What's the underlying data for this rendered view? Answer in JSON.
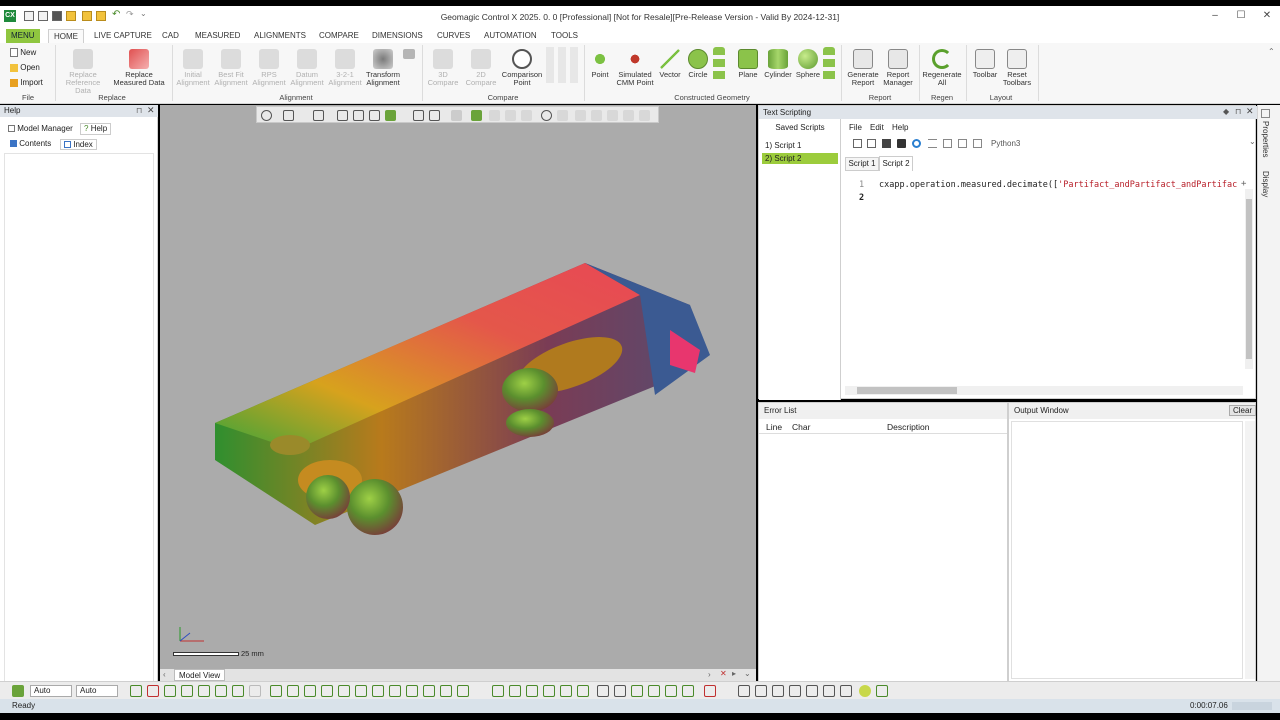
{
  "window": {
    "title": "Geomagic Control X 2025. 0. 0 [Professional] [Not for Resale][Pre-Release Version - Valid By 2024-12-31]",
    "logo_text": "CX"
  },
  "tabs": [
    "MENU",
    "HOME",
    "LIVE CAPTURE",
    "CAD",
    "MEASURED",
    "ALIGNMENTS",
    "COMPARE",
    "DIMENSIONS",
    "CURVES",
    "AUTOMATION",
    "TOOLS"
  ],
  "ribbon": {
    "file": {
      "new": "New",
      "open": "Open",
      "import": "Import",
      "label": "File"
    },
    "replace": {
      "replace_ref_1": "Replace",
      "replace_ref_2": "Reference Data",
      "replace_meas_1": "Replace",
      "replace_meas_2": "Measured Data",
      "label": "Replace"
    },
    "alignment": {
      "initial_1": "Initial",
      "initial_2": "Alignment",
      "bestfit_1": "Best Fit",
      "bestfit_2": "Alignment",
      "rps_1": "RPS",
      "rps_2": "Alignment",
      "datum_1": "Datum",
      "datum_2": "Alignment",
      "three21_1": "3-2-1",
      "three21_2": "Alignment",
      "transform_1": "Transform",
      "transform_2": "Alignment",
      "label": "Alignment"
    },
    "compare": {
      "c3d_1": "3D",
      "c3d_2": "Compare",
      "c2d_1": "2D",
      "c2d_2": "Compare",
      "cmp_pt_1": "Comparison",
      "cmp_pt_2": "Point",
      "label": "Compare"
    },
    "constructed": {
      "point": "Point",
      "sim_1": "Simulated",
      "sim_2": "CMM Point",
      "vector": "Vector",
      "circle": "Circle",
      "plane": "Plane",
      "cylinder": "Cylinder",
      "sphere": "Sphere",
      "label": "Constructed Geometry"
    },
    "report": {
      "gen_1": "Generate",
      "gen_2": "Report",
      "mgr_1": "Report",
      "mgr_2": "Manager",
      "label": "Report"
    },
    "regen": {
      "regen_1": "Regenerate",
      "regen_2": "All",
      "label": "Regen"
    },
    "layout": {
      "toolbar": "Toolbar",
      "reset_1": "Reset",
      "reset_2": "Toolbars",
      "label": "Layout"
    }
  },
  "help_panel": {
    "title": "Help",
    "tab_model_manager": "Model Manager",
    "tab_help": "Help",
    "contents": "Contents",
    "index": "Index"
  },
  "model_view": {
    "scale_label": "25 mm",
    "tab_label": "Model View"
  },
  "script_panel": {
    "title": "Text Scripting",
    "saved_header": "Saved Scripts",
    "saved_items": [
      "1) Script 1",
      "2) Script 2"
    ],
    "menu": [
      "File",
      "Edit",
      "Help"
    ],
    "language": "Python3",
    "tabs": [
      "Script 1",
      "Script 2"
    ],
    "line_numbers": [
      "1",
      "2"
    ],
    "code_line1_prefix": "cxapp.operation.measured.decimate([",
    "code_line1_string": "'Partifact_andPartifact_andPartifac"
  },
  "error_list": {
    "title": "Error List",
    "col_line": "Line",
    "col_char": "Char",
    "col_desc": "Description"
  },
  "output_window": {
    "title": "Output Window",
    "clear_label": "Clear"
  },
  "side_strip": {
    "properties": "Properties",
    "display": "Display"
  },
  "bottom_toolbar": {
    "combo1": "Auto",
    "combo2": "Auto"
  },
  "status": {
    "text": "Ready",
    "time": "0:00:07.06"
  },
  "colors": {
    "accent_green": "#8fc63f",
    "ribbon_bg": "#f7f7f7",
    "viewport_bg": "#ababab",
    "selected_item": "#9ccc3c"
  }
}
